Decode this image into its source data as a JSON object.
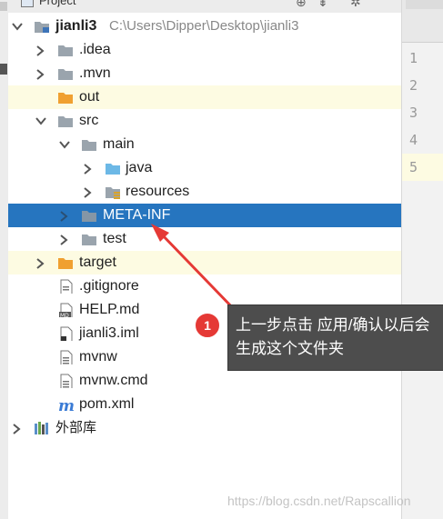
{
  "panel": {
    "title": "Project"
  },
  "tree": {
    "root": {
      "name": "jianli3",
      "path": "C:\\Users\\Dipper\\Desktop\\jianli3"
    },
    "idea": ".idea",
    "mvn": ".mvn",
    "out": "out",
    "src": "src",
    "main": "main",
    "java": "java",
    "resources": "resources",
    "metainf": "META-INF",
    "test": "test",
    "target": "target",
    "gitignore": ".gitignore",
    "help": "HELP.md",
    "iml": "jianli3.iml",
    "mvnw": "mvnw",
    "mvnwcmd": "mvnw.cmd",
    "pom": "pom.xml",
    "extlibs": "外部库"
  },
  "editor": {
    "lines": [
      "1",
      "2",
      "3",
      "4",
      "5"
    ]
  },
  "annotation": {
    "badge": "1",
    "text": "上一步点击 应用/确认以后会生成这个文件夹"
  },
  "watermark": "https://blog.csdn.net/Rapscallion",
  "colors": {
    "selection": "#2675bf",
    "highlight": "#fdfbe2",
    "folder_orange": "#f0a030",
    "folder_gray": "#9aa4ad",
    "folder_blue": "#6cb8e6",
    "badge": "#e53935"
  },
  "icons": {
    "project": "project-icon",
    "folder": "folder-icon",
    "source_folder": "source-folder-icon",
    "resource_folder": "resource-folder-icon",
    "excluded_folder": "excluded-folder-icon",
    "file": "file-icon",
    "markdown": "markdown-file-icon",
    "maven": "maven-icon",
    "libraries": "libraries-icon"
  }
}
